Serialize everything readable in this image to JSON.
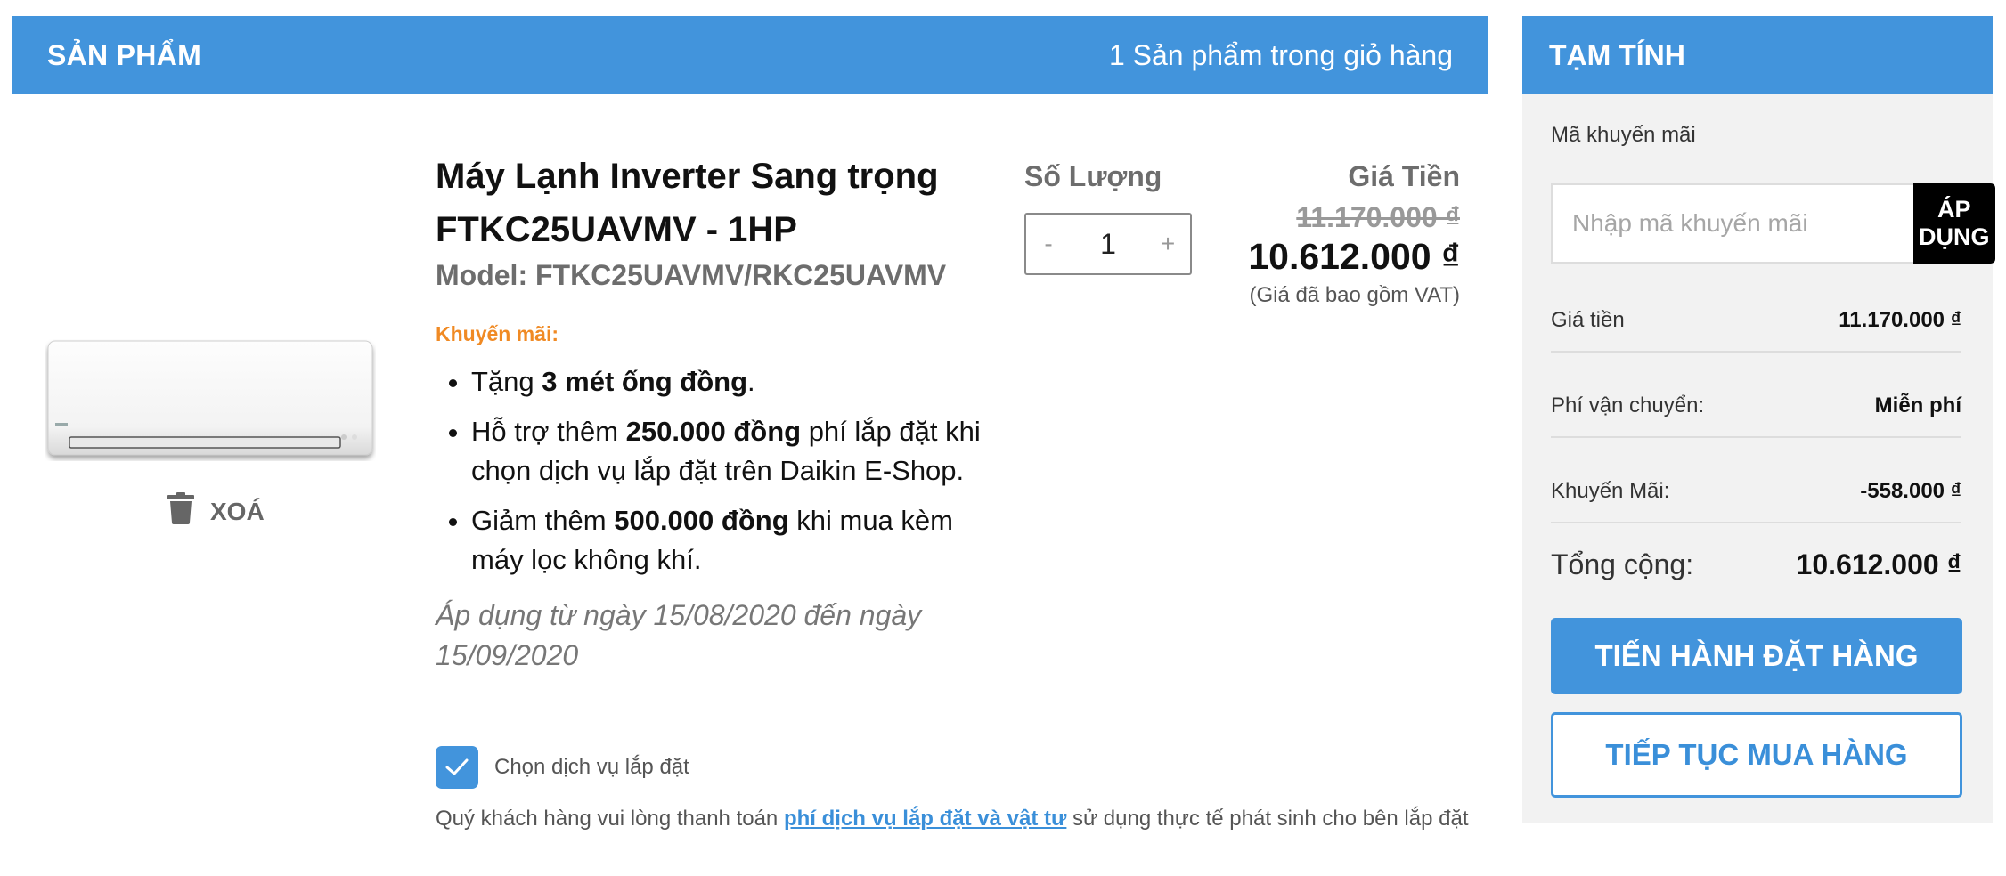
{
  "cart": {
    "header_title": "SẢN PHẨM",
    "item_count_text": "1 Sản phẩm trong giỏ hàng"
  },
  "product": {
    "name": "Máy Lạnh Inverter Sang trọng FTKC25UAVMV - 1HP",
    "model": "Model: FTKC25UAVMV/RKC25UAVMV",
    "promo_label": "Khuyến mãi:",
    "promos": [
      {
        "before": "Tặng ",
        "bold": "3 mét ống đồng",
        "after": "."
      },
      {
        "before": "Hỗ trợ thêm ",
        "bold": "250.000 đồng",
        "after": " phí lắp đặt khi chọn dịch vụ lắp đặt trên Daikin E-Shop."
      },
      {
        "before": "Giảm thêm ",
        "bold": "500.000 đồng",
        "after": " khi mua kèm máy lọc không khí."
      }
    ],
    "promo_dates": "Áp dụng từ ngày 15/08/2020 đến ngày 15/09/2020",
    "delete_label": "XOÁ",
    "install_label": "Chọn dịch vụ lắp đặt",
    "install_checked": true,
    "install_note_before": "Quý khách hàng vui lòng thanh toán ",
    "install_note_link": "phí dịch vụ lắp đặt và vật tư",
    "install_note_after": " sử dụng thực tế phát sinh cho bên lắp đặt"
  },
  "quantity": {
    "label": "Số Lượng",
    "minus": "-",
    "value": "1",
    "plus": "+"
  },
  "price": {
    "label": "Giá Tiền",
    "old": "11.170.000 ₫",
    "new": "10.612.000 ₫",
    "vat_note": "(Giá đã bao gồm VAT)"
  },
  "summary": {
    "header_title": "TẠM TÍNH",
    "coupon_label": "Mã khuyến mãi",
    "coupon_placeholder": "Nhập mã khuyến mãi",
    "apply_label": "ÁP DỤNG",
    "subtotal_label": "Giá tiền",
    "subtotal_value": "11.170.000 ₫",
    "shipping_label": "Phí vận chuyển:",
    "shipping_value": "Miễn phí",
    "discount_label": "Khuyến Mãi:",
    "discount_value": "-558.000 ₫",
    "total_label": "Tổng cộng:",
    "total_value": "10.612.000 ₫",
    "checkout_label": "TIẾN HÀNH ĐẶT HÀNG",
    "continue_label": "TIẾP TỤC MUA HÀNG"
  },
  "colors": {
    "primary": "#4294dc",
    "promo_orange": "#f08a24",
    "black_button": "#000000"
  }
}
